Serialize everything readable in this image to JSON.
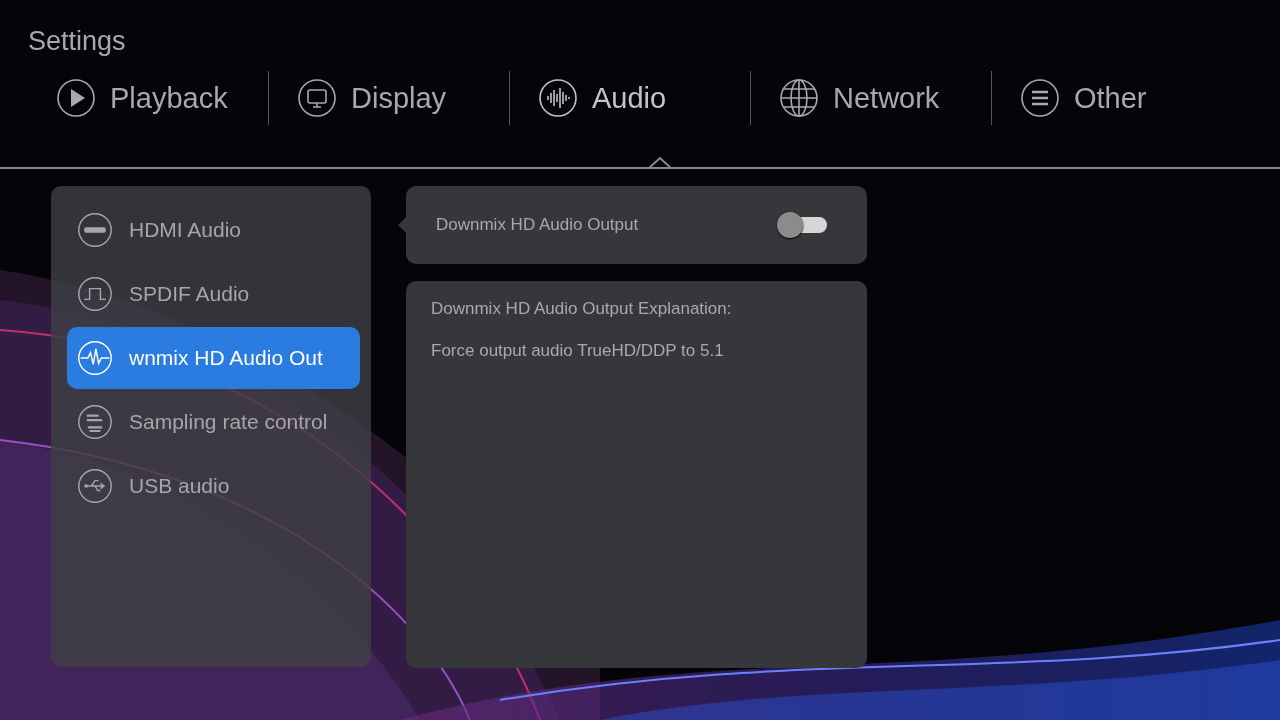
{
  "window": {
    "title": "Settings"
  },
  "tabs": [
    {
      "label": "Playback",
      "selected": false
    },
    {
      "label": "Display",
      "selected": false
    },
    {
      "label": "Audio",
      "selected": true
    },
    {
      "label": "Network",
      "selected": false
    },
    {
      "label": "Other",
      "selected": false
    }
  ],
  "sidebar": {
    "items": [
      {
        "label": "HDMI Audio",
        "selected": false
      },
      {
        "label": "SPDIF Audio",
        "selected": false
      },
      {
        "label": "wnmix HD Audio Out",
        "selected": true
      },
      {
        "label": "Sampling rate control",
        "selected": false
      },
      {
        "label": "USB audio",
        "selected": false
      }
    ]
  },
  "setting": {
    "label": "Downmix HD Audio Output",
    "on": false
  },
  "explanation": {
    "title": "Downmix HD Audio Output Explanation:",
    "text": "Force output audio TrueHD/DDP to 5.1"
  }
}
